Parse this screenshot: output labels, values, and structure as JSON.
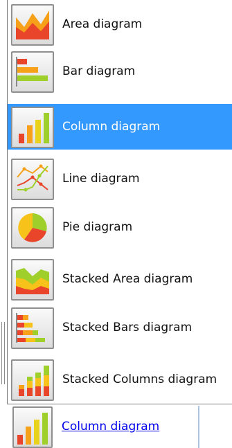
{
  "menu": {
    "items": [
      {
        "label": "Area diagram",
        "icon": "area-chart-icon"
      },
      {
        "label": "Bar diagram",
        "icon": "bar-chart-icon"
      },
      {
        "label": "Column diagram",
        "icon": "column-chart-icon",
        "selected": true
      },
      {
        "label": "Line diagram",
        "icon": "line-chart-icon"
      },
      {
        "label": "Pie diagram",
        "icon": "pie-chart-icon"
      },
      {
        "label": "Stacked Area diagram",
        "icon": "stacked-area-chart-icon"
      },
      {
        "label": "Stacked Bars diagram",
        "icon": "stacked-bars-chart-icon"
      },
      {
        "label": "Stacked Columns diagram",
        "icon": "stacked-columns-chart-icon"
      }
    ]
  },
  "current": {
    "label": "Column diagram",
    "icon": "column-chart-icon"
  },
  "colors": {
    "selection": "#3399ff",
    "red": "#e8452a",
    "orange": "#f7a11a",
    "yellow": "#e8d21a",
    "green": "#9fcf2a",
    "link": "#0000ee"
  }
}
